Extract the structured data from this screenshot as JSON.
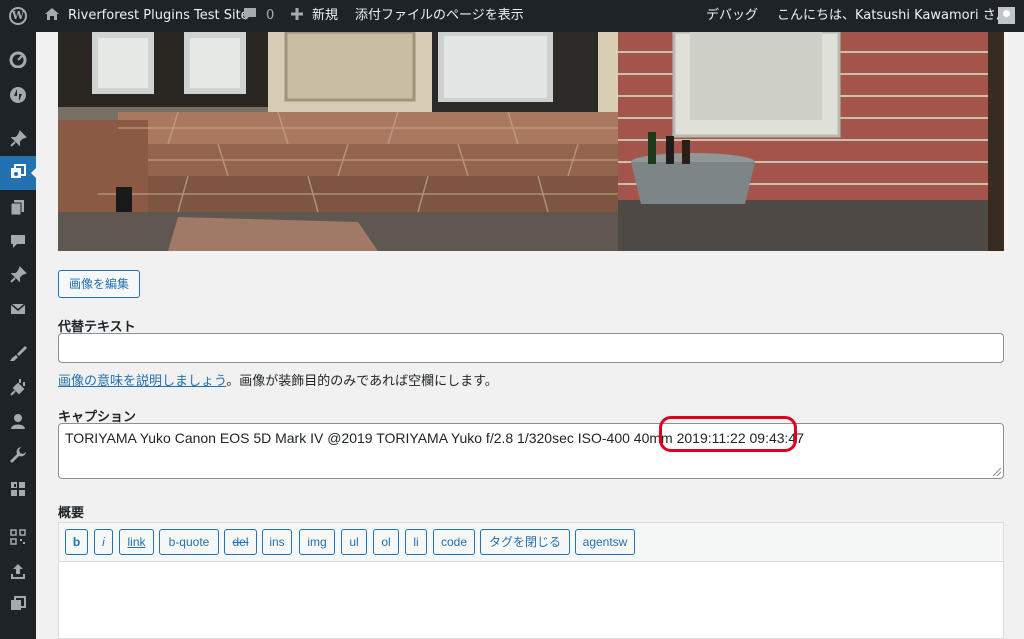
{
  "adminbar": {
    "site_name": "Riverforest Plugins Test Site",
    "comments_count": "0",
    "new_label": "新規",
    "view_attachment": "添付ファイルのページを表示",
    "debug_label": "デバッグ",
    "greeting": "こんにちは、Katsushi Kawamori さん"
  },
  "attachment": {
    "edit_image_button": "画像を編集",
    "alt_text_label": "代替テキスト",
    "alt_text_value": "",
    "alt_help_link": "画像の意味を説明しましょう",
    "alt_help_text": "。画像が装飾目的のみであれば空欄にします。",
    "caption_label": "キャプション",
    "caption_value": "TORIYAMA Yuko Canon EOS 5D Mark IV  @2019 TORIYAMA Yuko f/2.8 1/320sec ISO-400 40mm 2019:11:22 09:43:47",
    "description_label": "概要"
  },
  "quicktags": [
    "b",
    "i",
    "link",
    "b-quote",
    "del",
    "ins",
    "img",
    "ul",
    "ol",
    "li",
    "code",
    "タグを閉じる",
    "agentsw"
  ],
  "colors": {
    "admin_bar": "#1d2327",
    "accent": "#2271b1",
    "highlight": "#e0001b"
  }
}
